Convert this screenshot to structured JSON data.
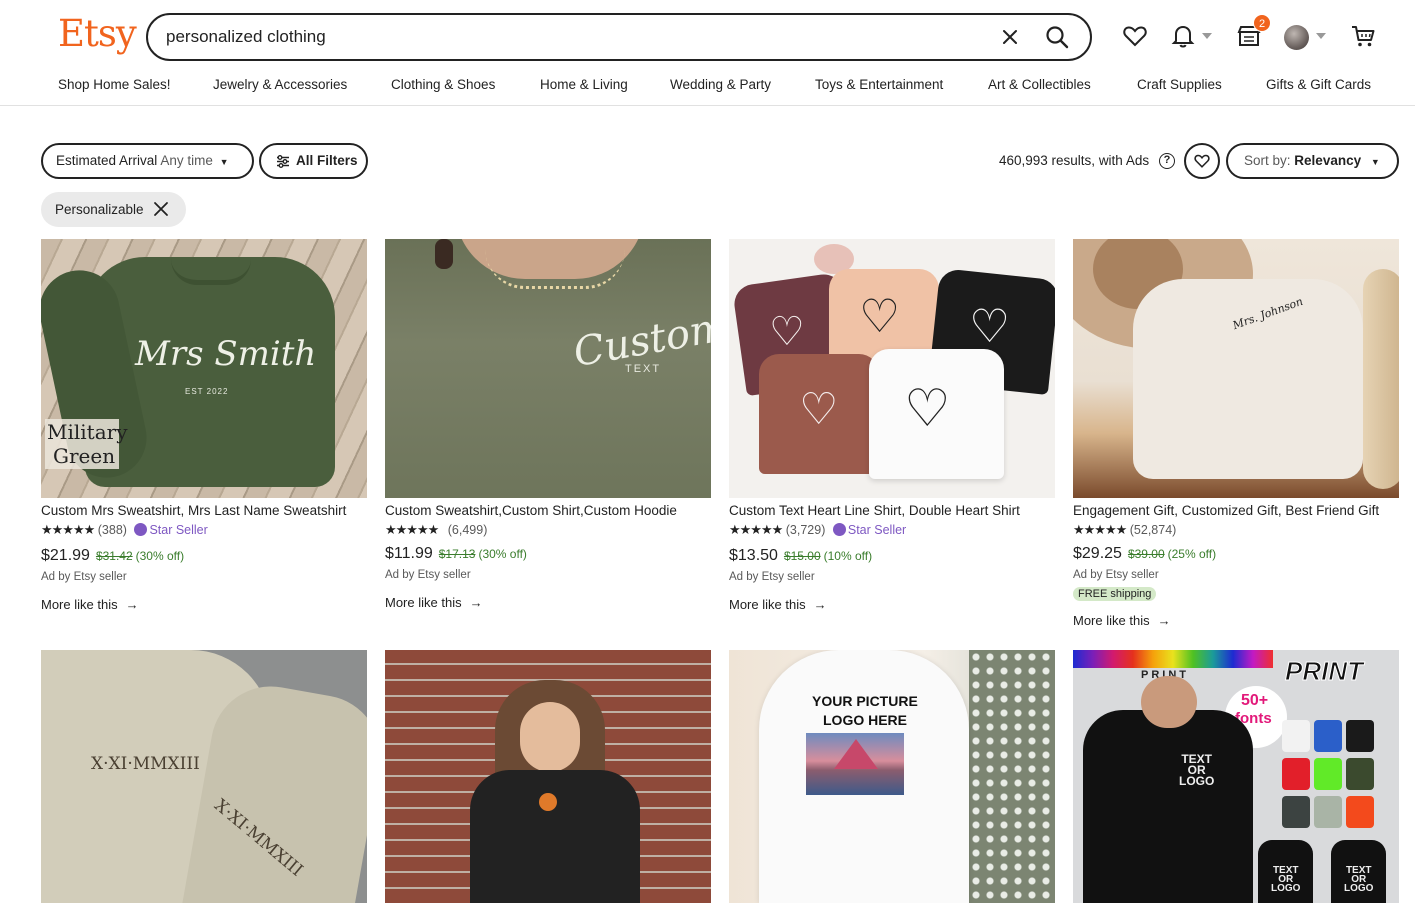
{
  "header": {
    "logo": "Etsy",
    "search_value": "personalized clothing",
    "cart_badge": "2"
  },
  "nav": [
    "Shop Home Sales!",
    "Jewelry & Accessories",
    "Clothing & Shoes",
    "Home & Living",
    "Wedding & Party",
    "Toys & Entertainment",
    "Art & Collectibles",
    "Craft Supplies",
    "Gifts & Gift Cards"
  ],
  "filters": {
    "arrival_label": "Estimated Arrival",
    "arrival_value": "Any time",
    "all_filters": "All Filters",
    "results": "460,993 results, with Ads",
    "sort_label": "Sort by:",
    "sort_value": "Relevancy",
    "chip": "Personalizable"
  },
  "products": [
    {
      "title": "Custom Mrs Sweatshirt, Mrs Last Name Sweatshirt",
      "stars": "★★★★★",
      "reviews": "(388)",
      "star_seller": "Star Seller",
      "price": "$21.99",
      "original": "$31.42",
      "discount": "(30% off)",
      "ad": "Ad by Etsy seller",
      "more": "More like this",
      "image_text": [
        "Mrs Smith",
        "EST 2022",
        "Military",
        "Green"
      ]
    },
    {
      "title": "Custom Sweatshirt,Custom Shirt,Custom Hoodie",
      "stars": "★★★★★",
      "reviews": "(6,499)",
      "price": "$11.99",
      "original": "$17.13",
      "discount": "(30% off)",
      "ad": "Ad by Etsy seller",
      "more": "More like this",
      "image_text": [
        "Custom",
        "TEXT"
      ]
    },
    {
      "title": "Custom Text Heart Line Shirt, Double Heart Shirt",
      "stars": "★★★★★",
      "reviews": "(3,729)",
      "star_seller": "Star Seller",
      "price": "$13.50",
      "original": "$15.00",
      "discount": "(10% off)",
      "ad": "Ad by Etsy seller",
      "more": "More like this",
      "image_text": []
    },
    {
      "title": "Engagement Gift, Customized Gift, Best Friend Gift",
      "stars": "★★★★★",
      "reviews": "(52,874)",
      "price": "$29.25",
      "original": "$39.00",
      "discount": "(25% off)",
      "ad": "Ad by Etsy seller",
      "free_shipping": "FREE shipping",
      "more": "More like this",
      "image_text": [
        "Mrs. Johnson"
      ]
    }
  ],
  "row2_images": [
    {
      "text": [
        "X·XI·MMXIII",
        "X·XI·MMXIII"
      ]
    },
    {
      "text": []
    },
    {
      "text": [
        "YOUR PICTURE",
        "LOGO HERE"
      ]
    },
    {
      "text": [
        "PRINT",
        "PRINT",
        "50+",
        "fonts",
        "TEXT",
        "OR",
        "LOGO"
      ]
    }
  ],
  "colors": {
    "brand": "#f1641e",
    "star_seller": "#7e58c2",
    "discount": "#3a7d2c",
    "free_shipping_bg": "#d4e9c8"
  }
}
